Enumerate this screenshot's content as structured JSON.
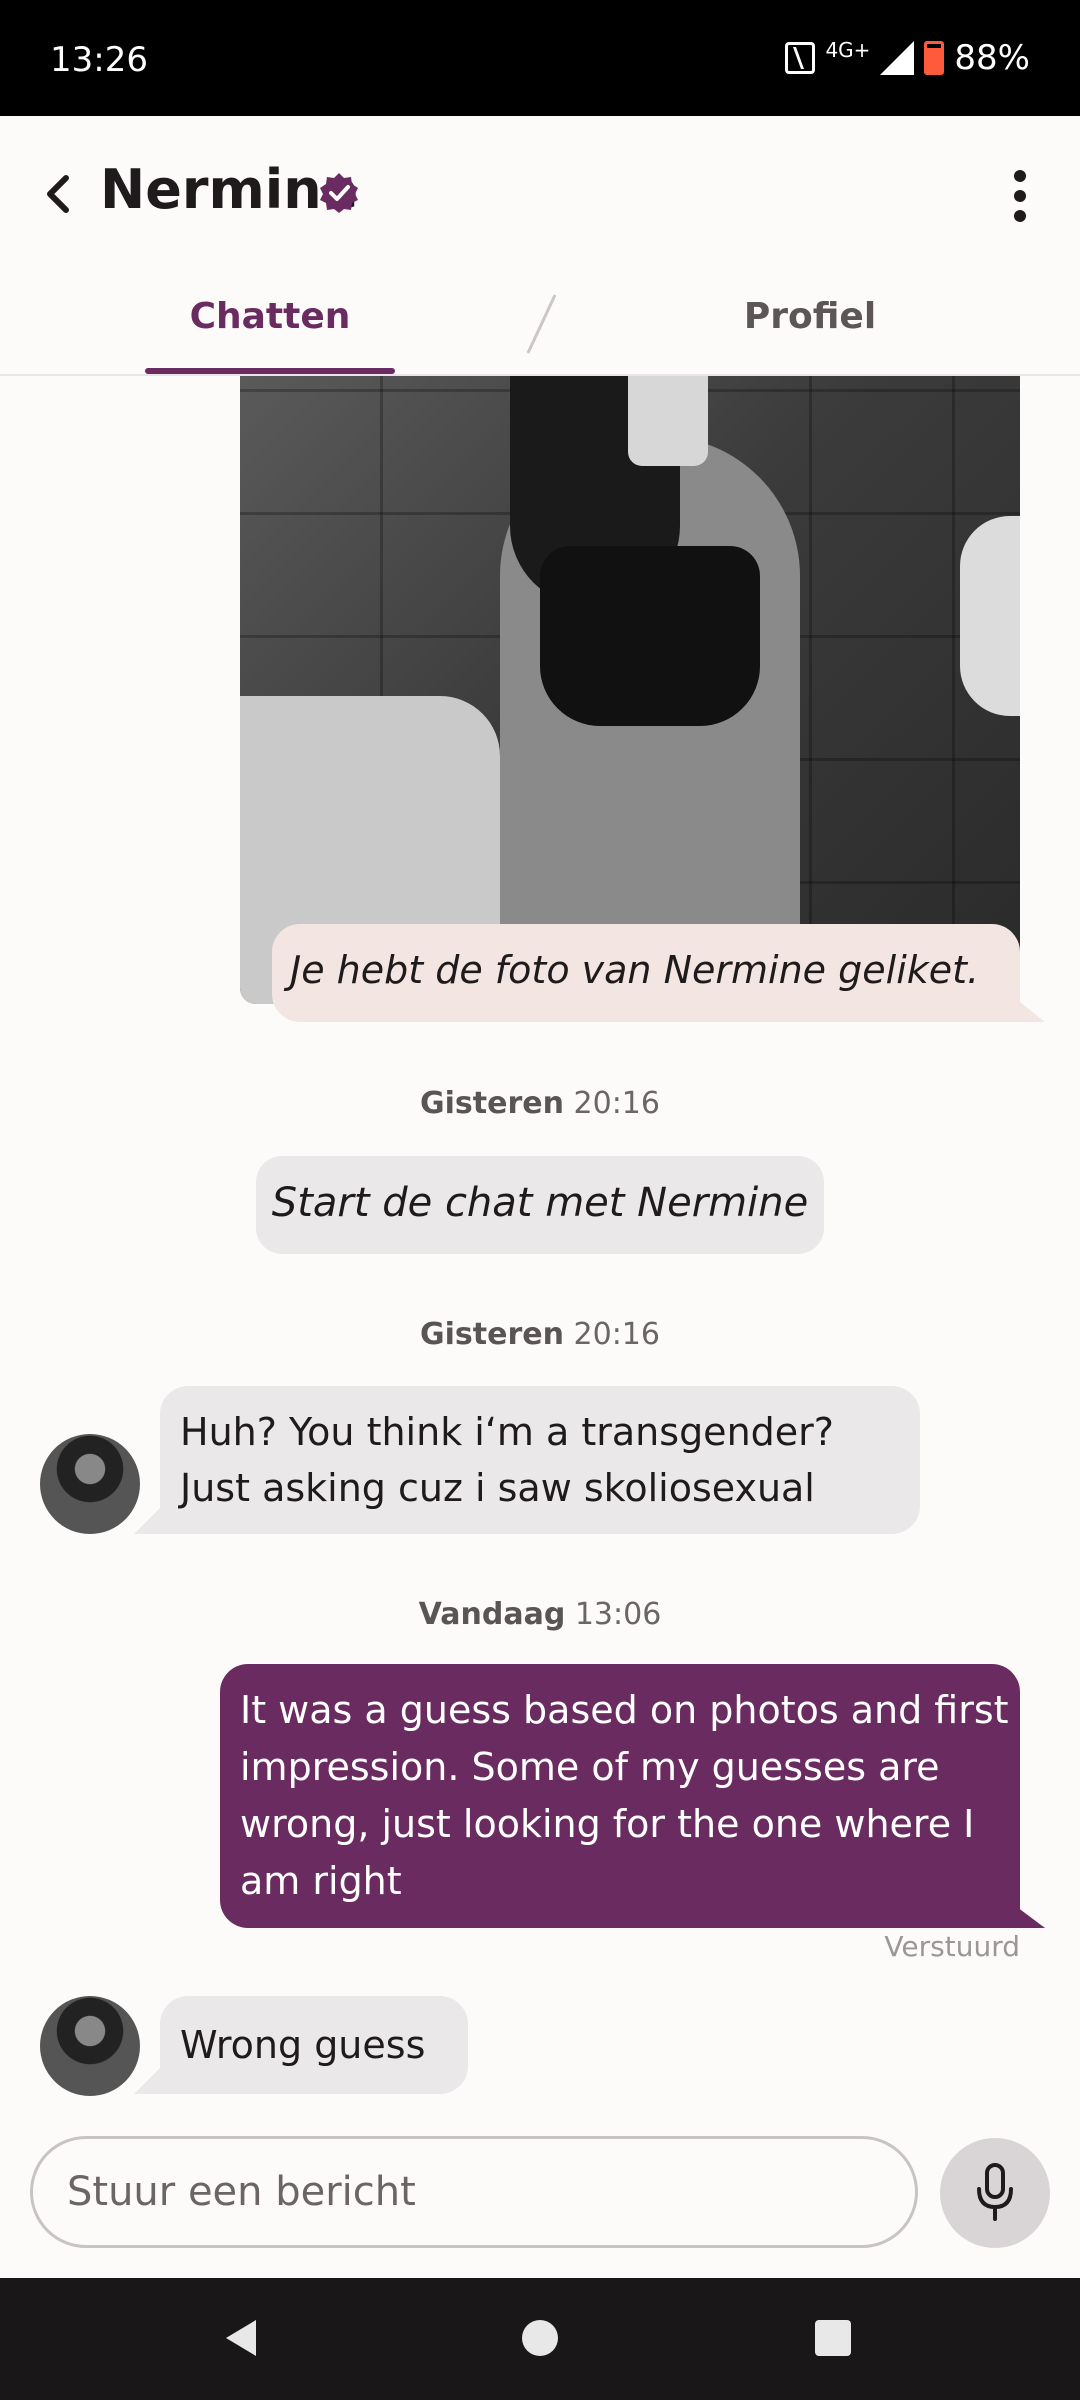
{
  "status_bar": {
    "time": "13:26",
    "network": "4G+",
    "battery": "88%",
    "icons": [
      "nfc-icon",
      "signal-icon",
      "battery-icon"
    ]
  },
  "header": {
    "title": "Nermine",
    "verified_icon": "verified-badge-icon",
    "back_icon": "back-chevron-icon",
    "menu_icon": "more-vertical-icon"
  },
  "tabs": [
    {
      "label": "Chatten",
      "active": true
    },
    {
      "label": "Profiel",
      "active": false
    }
  ],
  "conversation": {
    "photo_like_text": "Je hebt de foto van Nermine geliket.",
    "timestamp_1": {
      "day": "Gisteren",
      "time": "20:16"
    },
    "start_chip": "Start de chat met Nermine",
    "timestamp_2": {
      "day": "Gisteren",
      "time": "20:16"
    },
    "message_1": "Huh?  You think i‘m a transgender?\nJust asking cuz i saw skoliosexual",
    "timestamp_3": {
      "day": "Vandaag",
      "time": "13:06"
    },
    "message_2": "It was a guess based on photos and first impression. Some of my guesses are wrong, just looking for the one where I am right",
    "message_2_status": "Verstuurd",
    "message_3": "Wrong guess"
  },
  "composer": {
    "placeholder": "Stuur een bericht",
    "mic_icon": "microphone-icon"
  },
  "colors": {
    "accent": "#6a2b60",
    "received_bubble": "#ebe8e9",
    "like_bubble": "#f3e6e2",
    "background": "#fcfbfa"
  },
  "nav_bar": {
    "icons": [
      "nav-back-icon",
      "nav-home-icon",
      "nav-recents-icon"
    ]
  }
}
